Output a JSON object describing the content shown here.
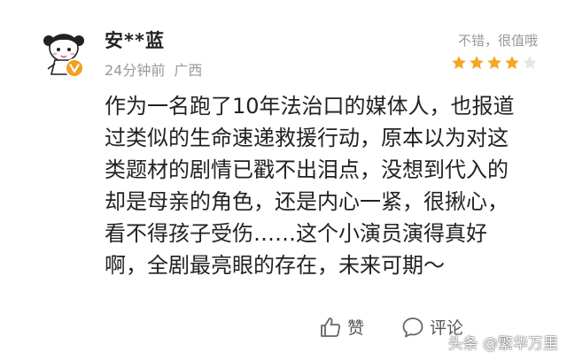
{
  "comment": {
    "username": "安**蓝",
    "time": "24分钟前",
    "location": "广西",
    "rating_text": "不错，很值哦",
    "rating": 4,
    "rating_max": 5,
    "review_lines": [
      "作为一名跑了10年法治口的媒体人，也报道",
      "过类似的生命速递救援行动，原本以为对这",
      "类题材的剧情已戳不出泪点，没想到代入的",
      "却是母亲的角色，还是内心一紧，很揪心，",
      "看不得孩子受伤……这个小演员演得真好",
      "啊，全剧最亮眼的存在，未来可期～"
    ],
    "like_label": "赞",
    "comment_label": "评论"
  },
  "watermark": "头条 @繁华万里",
  "icons": {
    "avatar": "cartoon-girl-avatar",
    "verified": "verified-v-badge",
    "like": "thumbs-up-icon",
    "comment": "speech-bubble-icon"
  },
  "colors": {
    "star_filled": "#f5a623",
    "star_empty": "#e6e6e6",
    "verified_badge": "#f0a020",
    "meta_text": "#999999"
  }
}
